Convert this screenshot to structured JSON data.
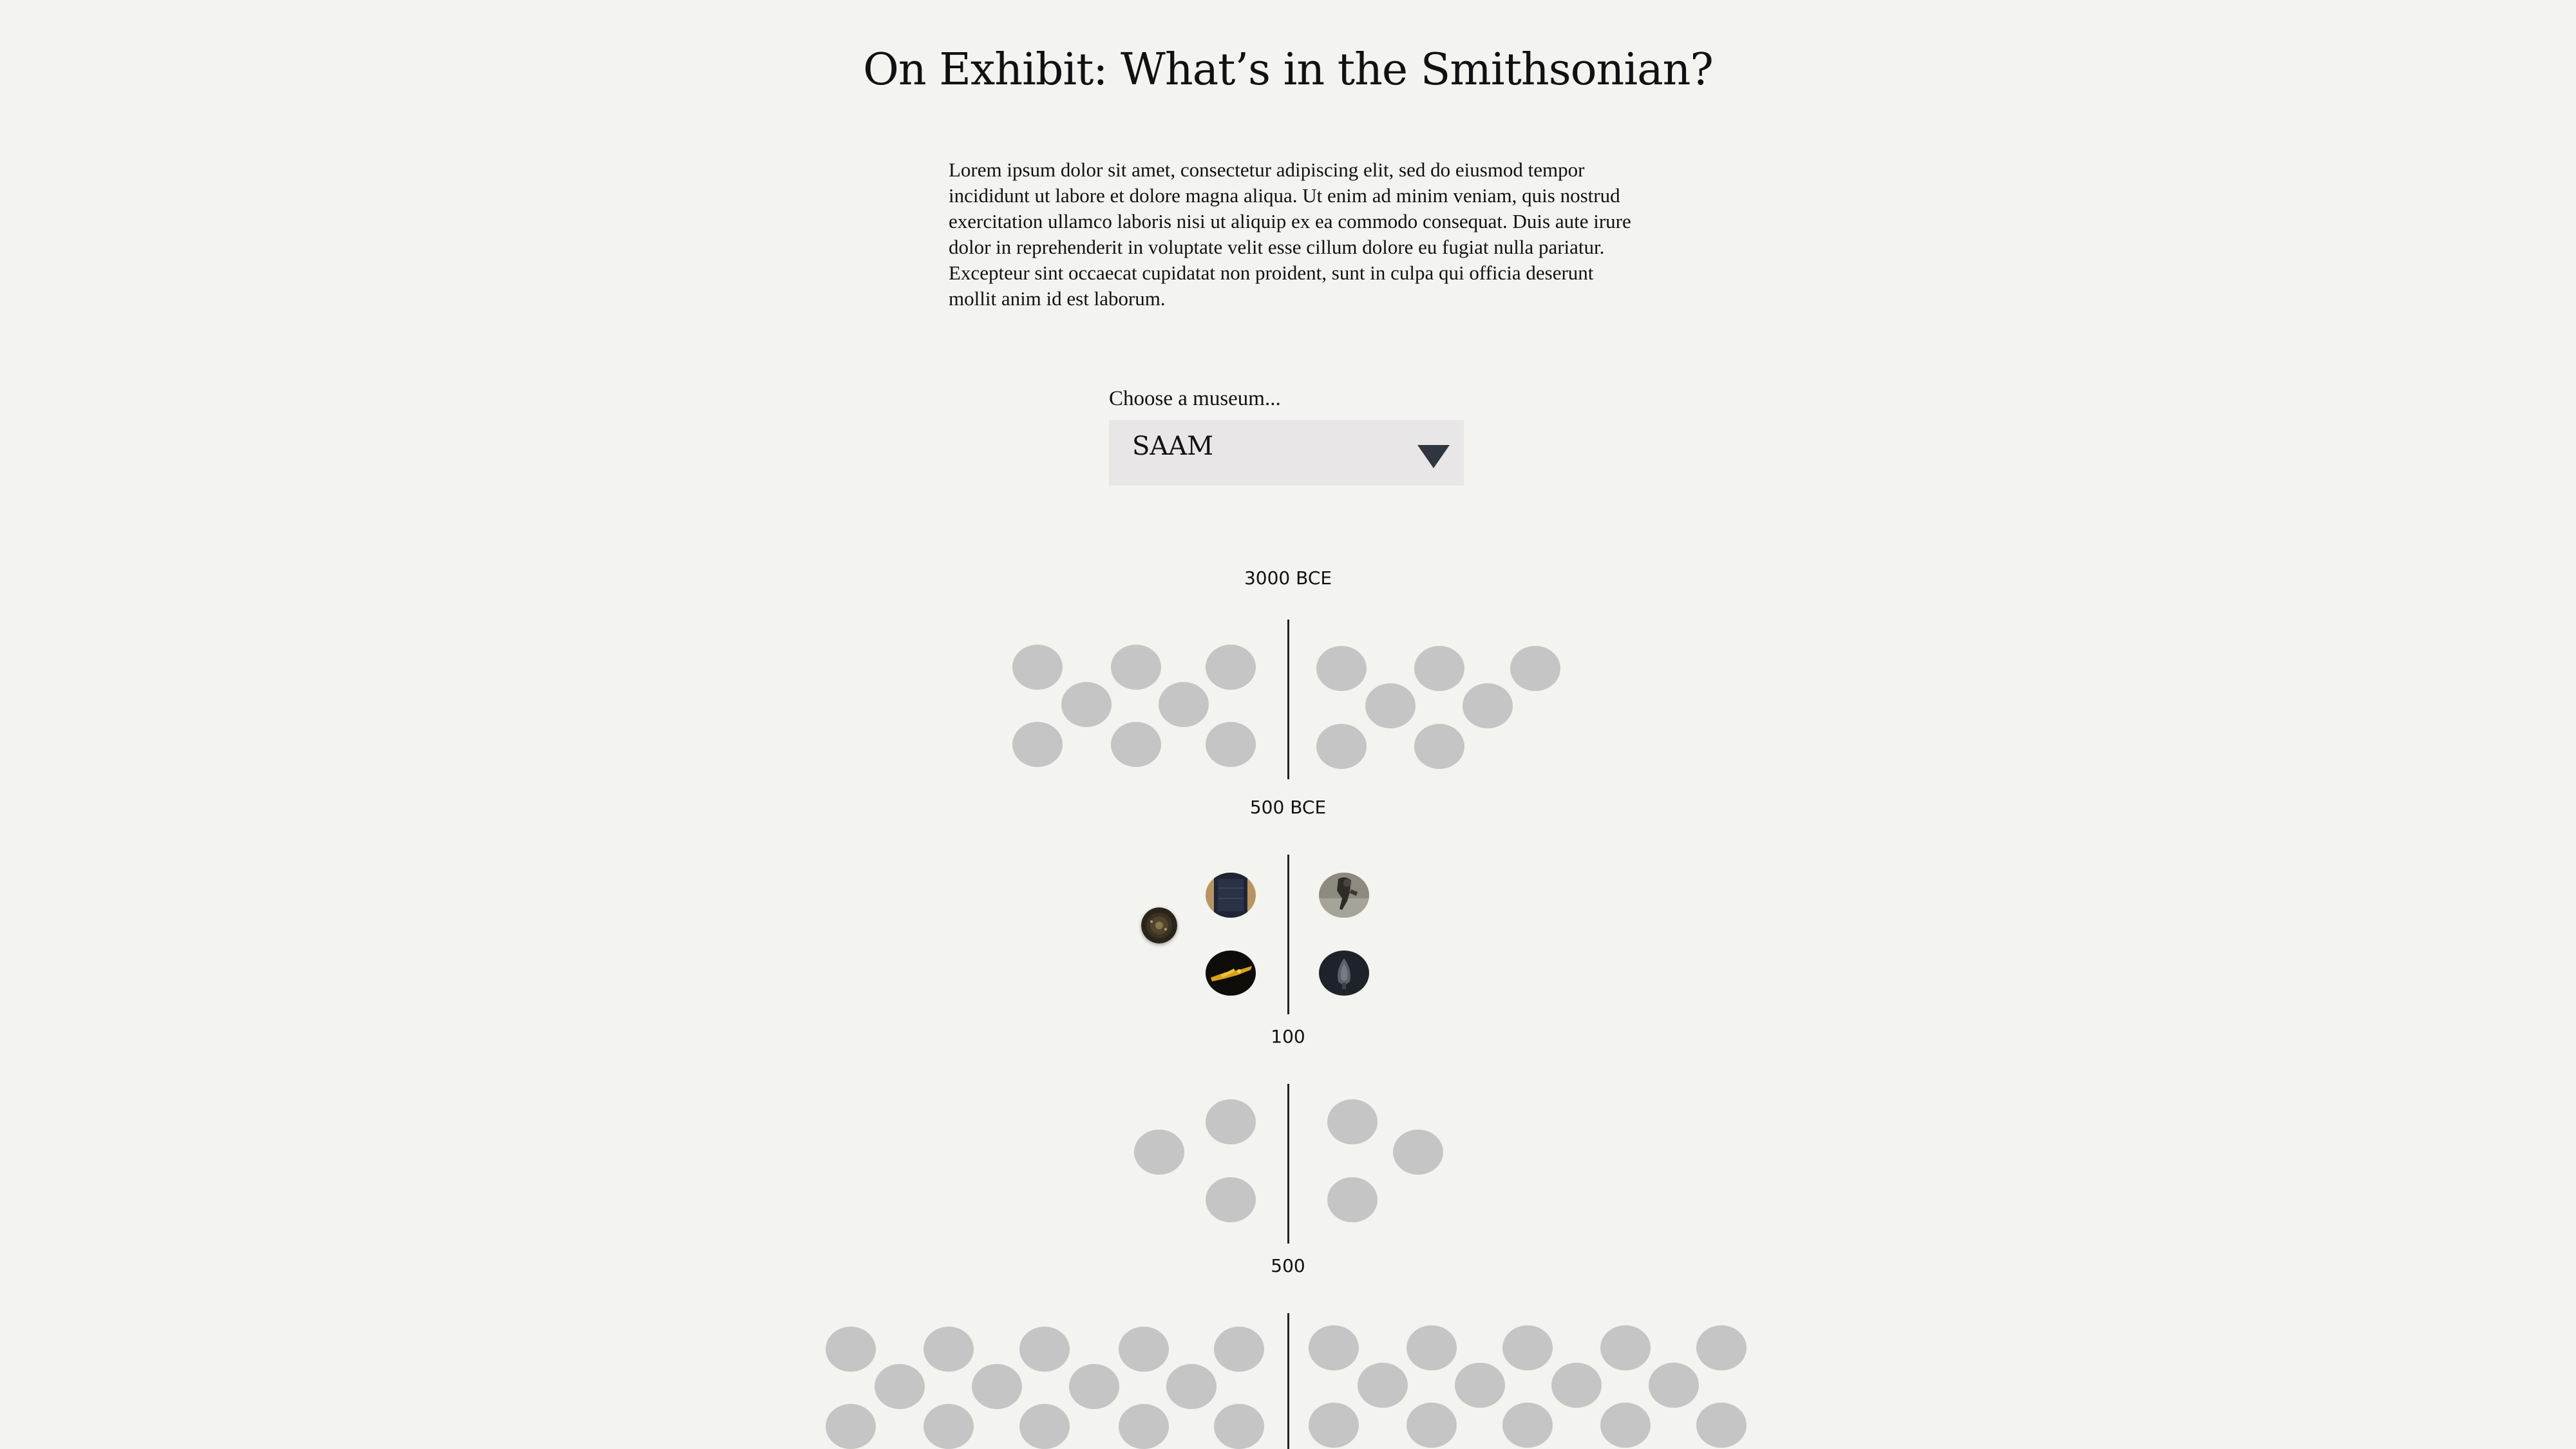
{
  "page": {
    "title": "On Exhibit: What’s in the Smithsonian?",
    "intro": "Lorem ipsum dolor sit amet, consectetur adipiscing elit, sed do eiusmod tempor incididunt ut labore et dolore magna aliqua. Ut enim ad minim veniam, quis nostrud exercitation ullamco laboris nisi ut aliquip ex ea commodo consequat. Duis aute irure dolor in reprehenderit in voluptate velit esse cillum dolore eu fugiat nulla pariatur. Excepteur sint occaecat cupidatat non proident, sunt in culpa qui officia deserunt mollit anim id est laborum."
  },
  "museum_select": {
    "label": "Choose a museum...",
    "value": "SAAM"
  },
  "timeline": {
    "eras": [
      {
        "label": "3000 BCE"
      },
      {
        "label": "500 BCE"
      },
      {
        "label": "100"
      },
      {
        "label": "500"
      }
    ]
  },
  "colors": {
    "background": "#f3f4ef",
    "placeholder_dot": "#c5c5c5",
    "select_background": "#e8e6e6",
    "arrow": "#2f3640",
    "line": "#222222"
  }
}
